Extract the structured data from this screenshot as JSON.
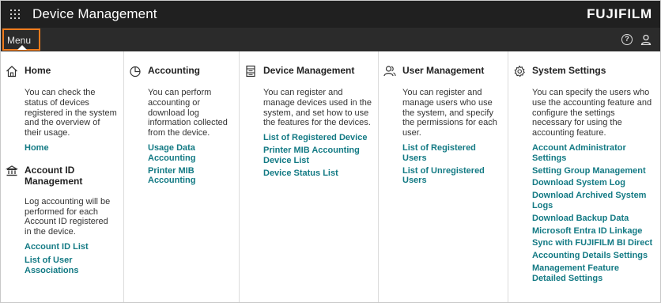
{
  "app": {
    "title": "Device Management",
    "brand": "FUJIFILM"
  },
  "menubar": {
    "menu_label": "Menu",
    "help_glyph": "?"
  },
  "icons": {
    "apps": "apps-grid-icon",
    "help": "help-icon",
    "user": "user-icon",
    "home": "home-icon",
    "account_id": "bank-icon",
    "accounting": "pie-chart-icon",
    "device": "device-icon",
    "users": "users-icon",
    "settings": "gear-icon"
  },
  "colors": {
    "appbar": "#202020",
    "menubar": "#2b2b2b",
    "highlight": "#f07b1c",
    "link": "#137a84"
  },
  "columns": [
    {
      "sections": [
        {
          "title": "Home",
          "description": "You can check the status of devices registered in the system and the overview of their usage.",
          "links": [
            "Home"
          ]
        },
        {
          "title": "Account ID Management",
          "description": "Log accounting will be performed for each Account ID registered in the device.",
          "links": [
            "Account ID List",
            "List of User Associations"
          ]
        }
      ]
    },
    {
      "sections": [
        {
          "title": "Accounting",
          "description": "You can perform accounting or download log information collected from the device.",
          "links": [
            "Usage Data Accounting",
            "Printer MIB Accounting"
          ]
        }
      ]
    },
    {
      "sections": [
        {
          "title": "Device Management",
          "description": "You can register and manage devices used in the system, and set how to use the features for the devices.",
          "links": [
            "List of Registered Device",
            "Printer MIB Accounting Device List",
            "Device Status List"
          ]
        }
      ]
    },
    {
      "sections": [
        {
          "title": "User Management",
          "description": "You can register and manage users who use the system, and specify the permissions for each user.",
          "links": [
            "List of Registered Users",
            "List of Unregistered Users"
          ]
        }
      ]
    },
    {
      "sections": [
        {
          "title": "System Settings",
          "description": "You can specify the users who use the accounting feature and configure the settings necessary for using the accounting feature.",
          "links": [
            "Account Administrator Settings",
            "Setting Group Management",
            "Download System Log",
            "Download Archived System Logs",
            "Download Backup Data",
            "Microsoft Entra ID Linkage",
            "Sync with FUJIFILM BI Direct",
            "Accounting Details Settings",
            "Management Feature Detailed Settings"
          ]
        }
      ]
    }
  ]
}
